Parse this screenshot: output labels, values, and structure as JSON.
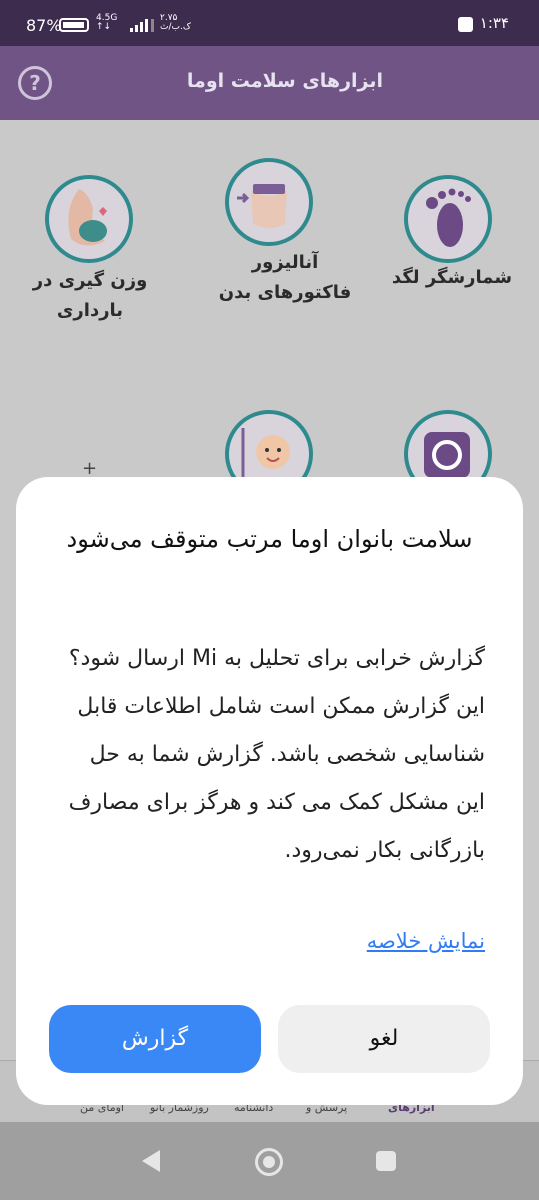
{
  "status_bar": {
    "time": "۱:۳۴",
    "battery": "87%",
    "network": "4.5G",
    "network_sub": "↑↓",
    "speed": "۲.۷۵",
    "speed_unit": "ک.ب/ث"
  },
  "app_bar": {
    "title": "ابزارهای سلامت اوما",
    "help": "?"
  },
  "tools": [
    {
      "label": "شمارشگر لگد",
      "icon": "footprint-icon"
    },
    {
      "label": "آنالیزور فاکتورهای بدن",
      "icon": "body-measure-icon"
    },
    {
      "label": "وزن گیری در بارداری",
      "icon": "pregnancy-icon"
    },
    {
      "label": "",
      "icon": "camera-shutter-icon"
    },
    {
      "label": "",
      "icon": "baby-growth-icon"
    }
  ],
  "plus": "+",
  "bottom_nav": {
    "items": [
      "ابزارهای",
      "پرسش و",
      "دانشنامه",
      "روزشمار بانو",
      "اومای من"
    ]
  },
  "dialog": {
    "title": "سلامت بانوان اوما مرتب متوقف می‌شود",
    "body": "گزارش خرابی برای تحلیل به Mi ارسال شود؟ این گزارش ممکن است شامل اطلاعات قابل شناسایی شخصی باشد. گزارش شما به حل این مشکل کمک می کند و هرگز برای مصارف بازرگانی بکار نمی‌رود.",
    "link": "نمایش خلاصه",
    "report_button": "گزارش",
    "cancel_button": "لغو"
  },
  "colors": {
    "status_bar": "#3e2c4f",
    "app_bar": "#6f5485",
    "accent": "#2f8a8e",
    "primary_button": "#3a88f5"
  }
}
